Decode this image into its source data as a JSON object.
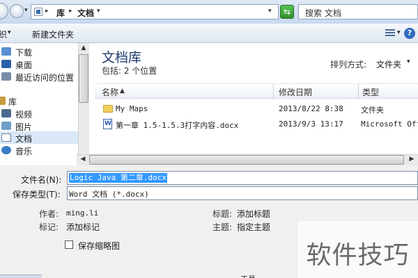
{
  "address_bar": {
    "path": [
      "库",
      "文档"
    ],
    "search_text": "搜索 文档"
  },
  "toolbar": {
    "organize_label": "织",
    "new_folder_label": "新建文件夹"
  },
  "nav": {
    "items": [
      {
        "label": "下载",
        "icon": "download-icon"
      },
      {
        "label": "桌面",
        "icon": "desktop-icon"
      },
      {
        "label": "最近访问的位置",
        "icon": "recent-places-icon"
      },
      {
        "label": "库",
        "icon": "library-icon"
      },
      {
        "label": "视频",
        "icon": "video-icon"
      },
      {
        "label": "图片",
        "icon": "picture-icon"
      },
      {
        "label": "文档",
        "icon": "document-icon",
        "selected": true
      },
      {
        "label": "音乐",
        "icon": "music-icon"
      }
    ]
  },
  "content": {
    "library_title": "文档库",
    "includes": "包括: 2 个位置",
    "arrange_label": "排列方式:",
    "arrange_value": "文件夹",
    "columns": [
      "名称",
      "修改日期",
      "类型"
    ],
    "files": [
      {
        "name": "My Maps",
        "date": "2013/8/22 8:38",
        "type": "文件夹",
        "icon": "folder-icon"
      },
      {
        "name": "第一章 1.5-1.5.3打字内容.docx",
        "date": "2013/9/3 13:17",
        "type": "Microsoft Offi",
        "icon": "word-doc-icon"
      }
    ]
  },
  "save": {
    "filename_label": "文件名(N):",
    "filename_value": "Logic Java 第二章.docx",
    "filetype_label": "保存类型(T):",
    "filetype_value": "Word 文档 (*.docx)",
    "author_label": "作者:",
    "author_value": "ming.li",
    "tags_label": "标记:",
    "tags_value": "添加标记",
    "title_label": "标题:",
    "title_value": "添加标题",
    "subject_label": "主题:",
    "subject_value": "指定主题",
    "thumbnail_label": "保存缩略图",
    "tools_partial": "工具"
  },
  "watermark": "软件技巧"
}
